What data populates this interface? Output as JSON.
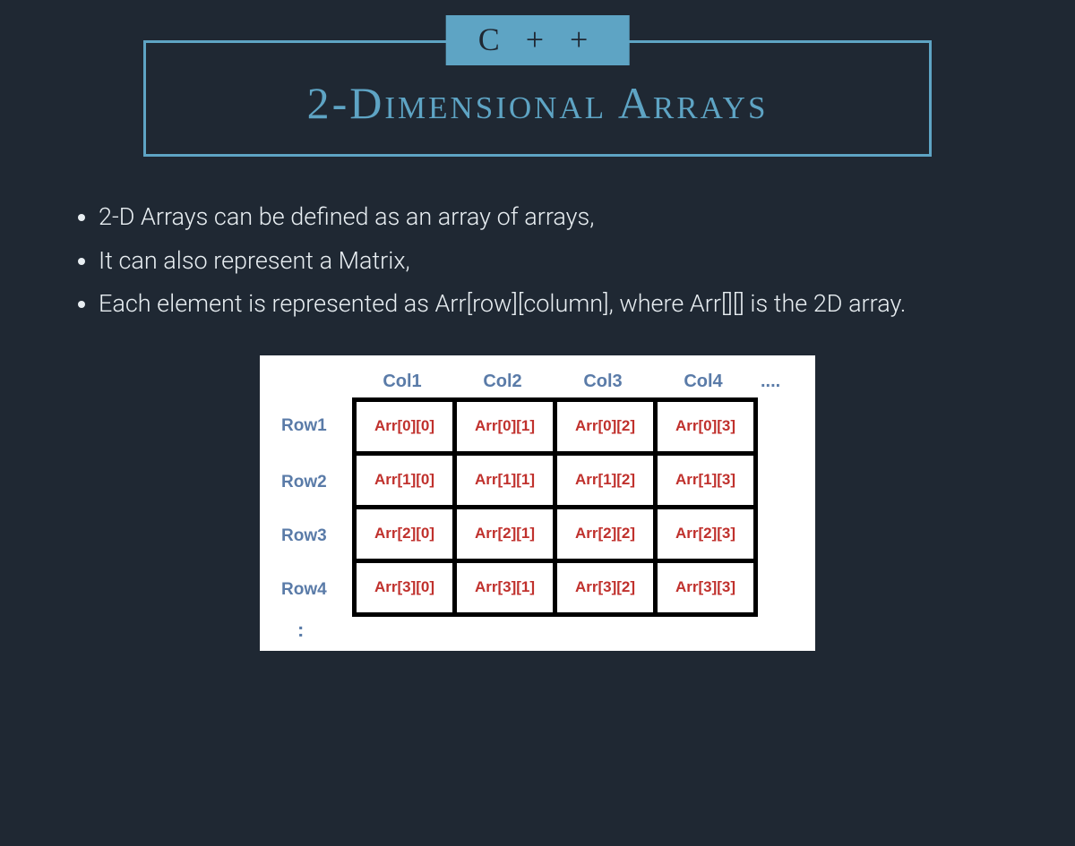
{
  "header": {
    "badge": "C + +",
    "title": "2-Dimensional Arrays"
  },
  "bullets": [
    "2-D Arrays can be defined as an array of arrays,",
    "It can also represent a Matrix,",
    "Each element is represented as Arr[row][column], where Arr[][] is the 2D array."
  ],
  "diagram": {
    "col_headers": [
      "Col1",
      "Col2",
      "Col3",
      "Col4"
    ],
    "col_ellipsis": "....",
    "row_labels": [
      "Row1",
      "Row2",
      "Row3",
      "Row4"
    ],
    "row_ellipsis": ":",
    "cells": [
      [
        "Arr[0][0]",
        "Arr[0][1]",
        "Arr[0][2]",
        "Arr[0][3]"
      ],
      [
        "Arr[1][0]",
        "Arr[1][1]",
        "Arr[1][2]",
        "Arr[1][3]"
      ],
      [
        "Arr[2][0]",
        "Arr[2][1]",
        "Arr[2][2]",
        "Arr[2][3]"
      ],
      [
        "Arr[3][0]",
        "Arr[3][1]",
        "Arr[3][2]",
        "Arr[3][3]"
      ]
    ]
  }
}
